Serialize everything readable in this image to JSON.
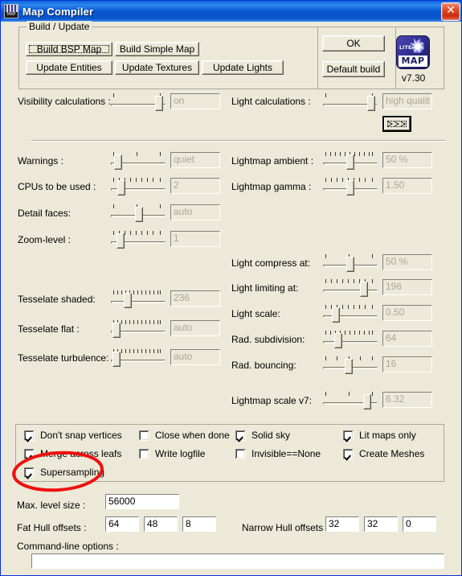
{
  "window": {
    "title": "Map Compiler",
    "close_label": "✕",
    "icon": "map-compiler-icon",
    "titlebar_color": "#0b55cc",
    "face_color": "#ece9d8"
  },
  "build_group": {
    "legend": "Build / Update",
    "buttons": [
      {
        "label": "Build BSP Map",
        "focused": true
      },
      {
        "label": "Build Simple Map",
        "focused": false
      },
      {
        "label": "Update Entities",
        "focused": false
      },
      {
        "label": "Update Textures",
        "focused": false
      },
      {
        "label": "Update Lights",
        "focused": false
      }
    ]
  },
  "action_group": {
    "ok_label": "OK",
    "default_build_label": "Default build",
    "version": "v7.30",
    "logo_top_text": "LITE",
    "logo_bottom_text": "MAP"
  },
  "top_sliders": [
    {
      "name": "visibility-calculations",
      "label": "Visibility calculations :",
      "value": "on",
      "pos": 0.9,
      "ticks": 2
    },
    {
      "name": "light-calculations",
      "label": "Light calculations :",
      "value": "high qualit",
      "pos": 0.9,
      "ticks": 2
    }
  ],
  "more_button": {
    "label": ">>>",
    "focused": true
  },
  "left_sliders": [
    {
      "name": "warnings",
      "label": "Warnings :",
      "value": "quiet",
      "pos": 0.06,
      "ticks": 3
    },
    {
      "name": "cpus-to-be-used",
      "label": "CPUs to be used :",
      "value": "2",
      "pos": 0.12,
      "ticks": 9
    },
    {
      "name": "detail-faces",
      "label": "Detail faces:",
      "value": "auto",
      "pos": 0.5,
      "ticks": 3
    },
    {
      "name": "zoom-level",
      "label": "Zoom-level :",
      "value": "1",
      "pos": 0.11,
      "ticks": 9
    },
    {
      "name": "tesselate-shaded",
      "label": "Tesselate shaded:",
      "value": "236",
      "pos": 0.26,
      "ticks": 13
    },
    {
      "name": "tesselate-flat",
      "label": "Tesselate flat :",
      "value": "auto",
      "pos": 0.03,
      "ticks": 13
    },
    {
      "name": "tesselate-turbulence",
      "label": "Tesselate turbulence:",
      "value": "auto",
      "pos": 0.03,
      "ticks": 13
    }
  ],
  "right_sliders": [
    {
      "name": "lightmap-ambient",
      "label": "Lightmap ambient :",
      "value": "50 %",
      "pos": 0.49,
      "ticks": 11
    },
    {
      "name": "lightmap-gamma",
      "label": "Lightmap gamma :",
      "value": "1.50",
      "pos": 0.49,
      "ticks": 9
    },
    {
      "name": "light-compress-at",
      "label": "Light compress at:",
      "value": "50 %",
      "pos": 0.49,
      "ticks": 3
    },
    {
      "name": "light-limiting-at",
      "label": "Light limiting at:",
      "value": "196",
      "pos": 0.76,
      "ticks": 9
    },
    {
      "name": "light-scale",
      "label": "Light scale:",
      "value": "0.50",
      "pos": 0.2,
      "ticks": 9
    },
    {
      "name": "rad-subdivision",
      "label": "Rad. subdivision:",
      "value": "64",
      "pos": 0.25,
      "ticks": 11
    },
    {
      "name": "rad-bouncing",
      "label": "Rad. bouncing:",
      "value": "16",
      "pos": 0.46,
      "ticks": 5
    },
    {
      "name": "lightmap-scale-v7",
      "label": "Lightmap scale v7:",
      "value": "6.32",
      "pos": 0.82,
      "ticks": 3
    }
  ],
  "checkboxes": [
    {
      "name": "dont-snap-vertices",
      "label": "Don't snap vertices",
      "checked": true
    },
    {
      "name": "merge-across-leafs",
      "label": "Merge across leafs",
      "checked": true
    },
    {
      "name": "supersampling",
      "label": "Supersampling",
      "checked": true
    },
    {
      "name": "close-when-done",
      "label": "Close when done",
      "checked": false
    },
    {
      "name": "write-logfile",
      "label": "Write logfile",
      "checked": false
    },
    {
      "name": "solid-sky",
      "label": "Solid sky",
      "checked": true
    },
    {
      "name": "invisible-equals-none",
      "label": "Invisible==None",
      "checked": false
    },
    {
      "name": "lit-maps-only",
      "label": "Lit maps only",
      "checked": true
    },
    {
      "name": "create-meshes",
      "label": "Create Meshes",
      "checked": true
    }
  ],
  "bottom": {
    "max_level_size_label": "Max. level size :",
    "max_level_size_value": "56000",
    "fat_hull_label": "Fat Hull offsets :",
    "fat_hull_values": [
      "64",
      "48",
      "8"
    ],
    "narrow_hull_label": "Narrow Hull offsets :",
    "narrow_hull_values": [
      "32",
      "32",
      "0"
    ],
    "command_line_label": "Command-line options :",
    "command_line_value": ""
  },
  "annotation": {
    "type": "red-ellipse",
    "color": "#ee1111",
    "targets": "supersampling"
  }
}
